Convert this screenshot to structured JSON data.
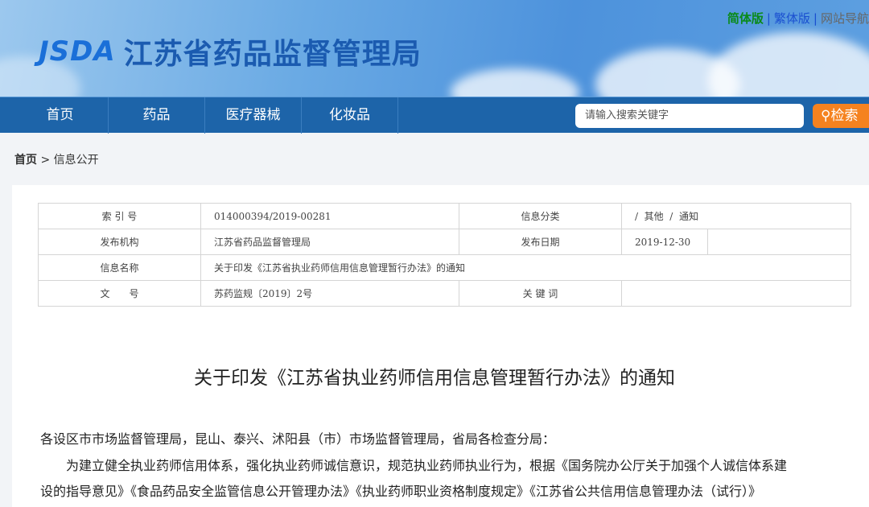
{
  "header": {
    "logo_en": "JSDA",
    "logo_cn": "江苏省药品监督管理局",
    "links": [
      "简体版",
      "繁体版",
      "网站导航"
    ]
  },
  "nav": {
    "items": [
      "首页",
      "药品",
      "医疗器械",
      "化妆品"
    ],
    "search_placeholder": "请输入搜索关键字",
    "search_button": "检索"
  },
  "breadcrumb": {
    "home": "首页",
    "sep": ">",
    "current": "信息公开"
  },
  "meta": {
    "index_label": "索 引 号",
    "index_value": "014000394/2019-00281",
    "category_label": "信息分类",
    "category_value": "/  其他  /  通知",
    "org_label": "发布机构",
    "org_value": "江苏省药品监督管理局",
    "date_label": "发布日期",
    "date_value": "2019-12-30",
    "name_label": "信息名称",
    "name_value": "关于印发《江苏省执业药师信用信息管理暂行办法》的通知",
    "docno_label": "文　　号",
    "docno_value": "苏药监规〔2019〕2号",
    "keywords_label": "关 键 词",
    "keywords_value": ""
  },
  "article": {
    "title": "关于印发《江苏省执业药师信用信息管理暂行办法》的通知",
    "lines": [
      "各设区市市场监督管理局，昆山、泰兴、沭阳县（市）市场监督管理局，省局各检查分局：",
      "为建立健全执业药师信用体系，强化执业药师诚信意识，规范执业药师执业行为，根据《国务院办公厅关于加强个人诚信体系建",
      "设的指导意见》《食品药品安全监管信息公开管理办法》《执业药师职业资格制度规定》《江苏省公共信用信息管理办法（试行）》"
    ]
  }
}
